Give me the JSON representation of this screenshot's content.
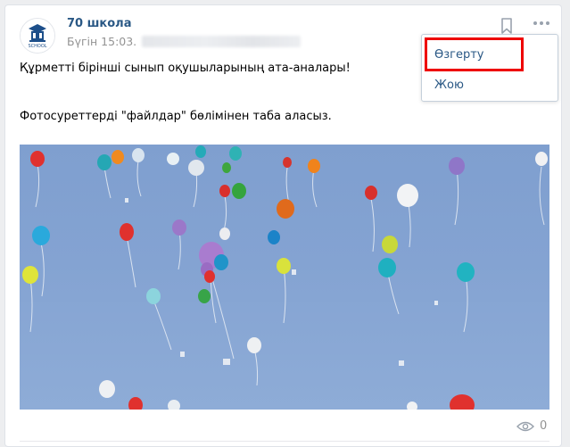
{
  "post": {
    "author": "70 школа",
    "date": "Бүгін 15:03.",
    "avatar_caption": "SCHOOL",
    "text_line1": "Құрметті бірінші сынып оқушыларының ата-аналары!",
    "text_line2": "Фотосуреттерді \"файлдар\" бөлімінен таба аласыз.",
    "views": "0"
  },
  "icons": {
    "bookmark": "bookmark-icon",
    "more": "more-horizontal-icon",
    "views": "eye-icon"
  },
  "menu": {
    "edit_label": "Өзгерту",
    "delete_label": "Жою"
  },
  "colors": {
    "link": "#2a5885",
    "muted": "#939393",
    "highlight": "#e00000",
    "sky": "#84a3d2"
  }
}
